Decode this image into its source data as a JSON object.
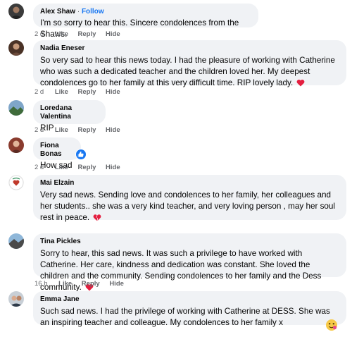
{
  "actions": {
    "like": "Like",
    "reply": "Reply",
    "hide": "Hide"
  },
  "comments": [
    {
      "author": "Alex Shaw",
      "follow": "Follow",
      "separator": "·",
      "text": "I'm so sorry to hear this. Sincere condolences from the Shaws.",
      "time": "2 d"
    },
    {
      "author": "Nadia Eneser",
      "text": "So very sad to hear this news today. I had the pleasure of working with Catherine who was such a dedicated teacher and the children loved her. My deepest condolences go to her family at this very difficult time. RIP lovely lady.",
      "time": "2 d",
      "reaction": "heart"
    },
    {
      "author": "Loredana Valentina",
      "text": "RIP",
      "time": "2 d"
    },
    {
      "author": "Fiona Bonas",
      "text": "How sad",
      "time": "2 d",
      "reaction": "like"
    },
    {
      "author": "Mai Elzain",
      "text": "Very sad news. Sending love and condolences to her family, her colleagues and her students.. she was a very kind teacher, and very loving person , may her soul rest in peace.",
      "time": "2 d",
      "reaction": "broken-heart"
    },
    {
      "author": "Tina Pickles",
      "text": "Sorry to hear, this sad news. It was such a privilege to have worked with Catherine. Her care, kindness and dedication was constant. She loved the children and the community. Sending condolences to her family and the Dess community.",
      "time": "16 h",
      "reaction": "heart"
    },
    {
      "author": "Emma Jane",
      "text": "Such sad news. I had the privilege of working with Catherine at DESS. She was an inspiring teacher and colleague. My condolences to her family x",
      "reaction": "emoji-picker"
    }
  ],
  "colors": {
    "bubble": "#f0f2f5",
    "meta": "#65676b",
    "link": "#1877f2",
    "heart": "#e41e3f"
  }
}
